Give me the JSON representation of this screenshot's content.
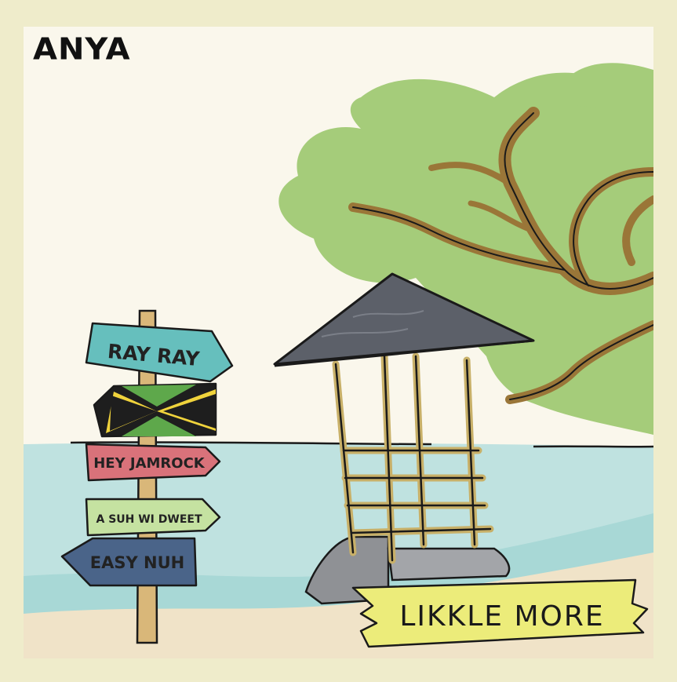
{
  "artist": "ANYA",
  "signs": [
    {
      "label": "RAY RAY",
      "color": "#66bfbd"
    },
    {
      "label": "",
      "flag": "jamaica-flag"
    },
    {
      "label": "HEY JAMROCK",
      "color": "#d9727a"
    },
    {
      "label": "A SUH WI DWEET",
      "color": "#c5e2a1"
    },
    {
      "label": "EASY NUH",
      "color": "#4a6489"
    }
  ],
  "title_banner": {
    "label": "LIKKLE MORE",
    "color": "#ecec7a"
  },
  "colors": {
    "background": "#efeccb",
    "sky": "#faf7ec",
    "sea": "#bfe2e0",
    "sand": "#f0e3c8",
    "foliage": "#a5cc7a",
    "trunk": "#9a7638",
    "roof": "#5c6069",
    "hut_wood": "#c8b068"
  }
}
